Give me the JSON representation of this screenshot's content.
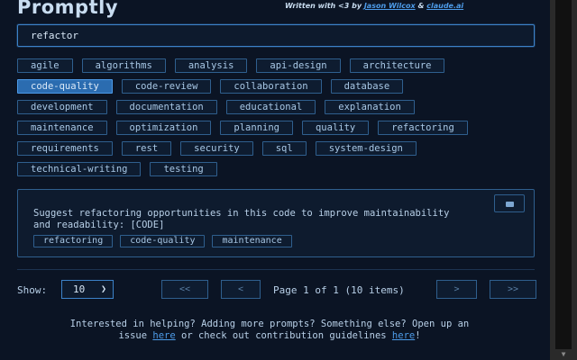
{
  "app": {
    "title": "Promptly",
    "credit_prefix": "Written with <3 by",
    "credit_author": "Jason Wilcox",
    "credit_amp": "&",
    "credit_tool": "claude.ai"
  },
  "search": {
    "value": "refactor",
    "placeholder": ""
  },
  "tag_rows": [
    [
      {
        "label": "agile",
        "active": false
      },
      {
        "label": "algorithms",
        "active": false
      },
      {
        "label": "analysis",
        "active": false
      },
      {
        "label": "api-design",
        "active": false
      },
      {
        "label": "architecture",
        "active": false
      }
    ],
    [
      {
        "label": "code-quality",
        "active": true
      },
      {
        "label": "code-review",
        "active": false
      },
      {
        "label": "collaboration",
        "active": false
      },
      {
        "label": "database",
        "active": false
      }
    ],
    [
      {
        "label": "development",
        "active": false
      },
      {
        "label": "documentation",
        "active": false
      },
      {
        "label": "educational",
        "active": false
      },
      {
        "label": "explanation",
        "active": false
      }
    ],
    [
      {
        "label": "maintenance",
        "active": false
      },
      {
        "label": "optimization",
        "active": false
      },
      {
        "label": "planning",
        "active": false
      },
      {
        "label": "quality",
        "active": false
      },
      {
        "label": "refactoring",
        "active": false
      }
    ],
    [
      {
        "label": "requirements",
        "active": false
      },
      {
        "label": "rest",
        "active": false
      },
      {
        "label": "security",
        "active": false
      },
      {
        "label": "sql",
        "active": false
      },
      {
        "label": "system-design",
        "active": false
      }
    ],
    [
      {
        "label": "technical-writing",
        "active": false
      },
      {
        "label": "testing",
        "active": false
      }
    ]
  ],
  "result": {
    "text": "Suggest refactoring opportunities in this code to improve maintainability and readability: [CODE]",
    "tags": [
      "refactoring",
      "code-quality",
      "maintenance"
    ],
    "copy_icon": "clipboard-icon"
  },
  "pagination": {
    "show_label": "Show:",
    "page_size": "10",
    "first": "<<",
    "prev": "<",
    "page_info": "Page 1 of 1 (10 items)",
    "next": ">",
    "last": ">>"
  },
  "footer": {
    "line1": "Interested in helping? Adding more prompts? Something else? Open up an",
    "line2_a": "issue",
    "link1": "here",
    "line2_b": "or check out contribution guidelines",
    "link2": "here",
    "line2_end": "!"
  },
  "colors": {
    "accent": "#4d9be8",
    "background": "#0b1424",
    "active_tag": "#2b6cb0"
  }
}
